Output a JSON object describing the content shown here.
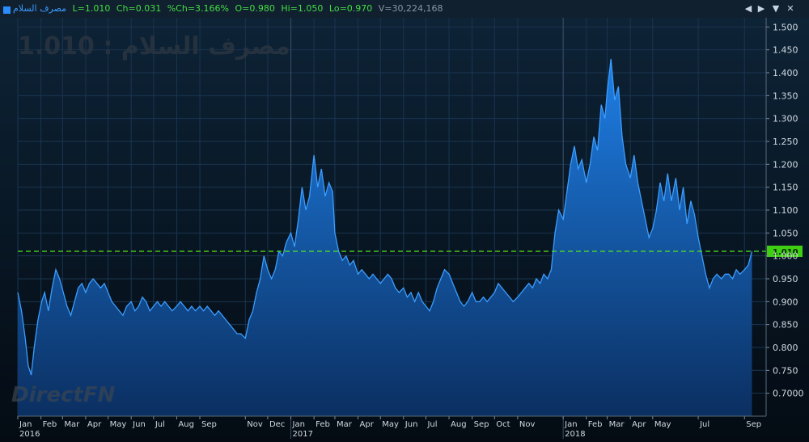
{
  "header": {
    "name": "مصرف السلام",
    "last": "L=1.010",
    "change": "Ch=0.031",
    "pct_change": "%Ch=3.166%",
    "open": "O=0.980",
    "high": "Hi=1.050",
    "low": "Lo=0.970",
    "volume": "V=30,224,168",
    "prev_icon": "triangle-left-icon",
    "next_icon": "triangle-right-icon",
    "menu_icon": "triangle-down-icon",
    "close_icon": "close-icon"
  },
  "watermark": {
    "label": "مصرف السلام",
    "sep": " : ",
    "value": "1.010"
  },
  "logo": "DirectFN",
  "colors": {
    "background": "#060f1a",
    "fill_top": "#1e7fe6",
    "fill_bottom": "#0b2f61",
    "line": "#3b9dff",
    "last_line": "#52e81c",
    "grid": "#1a3550",
    "axis_text": "#d0d8e0",
    "up_text": "#44dd44",
    "name_text": "#3a9bff"
  },
  "chart_data": {
    "type": "area",
    "ylim": [
      0.65,
      1.52
    ],
    "ytick_values": [
      0.7,
      0.75,
      0.8,
      0.85,
      0.9,
      0.95,
      1.0,
      1.05,
      1.1,
      1.15,
      1.2,
      1.25,
      1.3,
      1.35,
      1.4,
      1.45,
      1.5
    ],
    "ytick_labels": [
      "0.7000",
      "0.750",
      "0.800",
      "0.850",
      "0.900",
      "0.950",
      "1.000",
      "1.050",
      "1.100",
      "1.150",
      "1.200",
      "1.250",
      "1.300",
      "1.350",
      "1.400",
      "1.450",
      "1.500"
    ],
    "xlim": [
      "2016-01-01",
      "2018-09-30"
    ],
    "month_ticks": [
      {
        "date": "2016-01-01",
        "label": "Jan",
        "year": "2016"
      },
      {
        "date": "2016-02-01",
        "label": "Feb"
      },
      {
        "date": "2016-03-01",
        "label": "Mar"
      },
      {
        "date": "2016-04-01",
        "label": "Apr"
      },
      {
        "date": "2016-05-01",
        "label": "May"
      },
      {
        "date": "2016-06-01",
        "label": "Jun"
      },
      {
        "date": "2016-07-01",
        "label": "Jul"
      },
      {
        "date": "2016-08-01",
        "label": "Aug"
      },
      {
        "date": "2016-09-01",
        "label": "Sep"
      },
      {
        "date": "2016-11-01",
        "label": "Nov"
      },
      {
        "date": "2016-12-01",
        "label": "Dec"
      },
      {
        "date": "2017-01-01",
        "label": "Jan",
        "year": "2017"
      },
      {
        "date": "2017-02-01",
        "label": "Feb"
      },
      {
        "date": "2017-03-01",
        "label": "Mar"
      },
      {
        "date": "2017-04-01",
        "label": "Apr"
      },
      {
        "date": "2017-05-01",
        "label": "May"
      },
      {
        "date": "2017-06-01",
        "label": "Jun"
      },
      {
        "date": "2017-07-01",
        "label": "Jul"
      },
      {
        "date": "2017-08-01",
        "label": "Aug"
      },
      {
        "date": "2017-09-01",
        "label": "Sep"
      },
      {
        "date": "2017-10-01",
        "label": "Oct"
      },
      {
        "date": "2017-11-01",
        "label": "Nov"
      },
      {
        "date": "2018-01-01",
        "label": "Jan",
        "year": "2018"
      },
      {
        "date": "2018-02-01",
        "label": "Feb"
      },
      {
        "date": "2018-03-01",
        "label": "Mar"
      },
      {
        "date": "2018-04-01",
        "label": "Apr"
      },
      {
        "date": "2018-05-01",
        "label": "May"
      },
      {
        "date": "2018-07-01",
        "label": "Jul"
      },
      {
        "date": "2018-09-01",
        "label": "Sep"
      }
    ],
    "year_dividers": [
      "2017-01-01",
      "2018-01-01"
    ],
    "last_value": 1.01,
    "last_label": "1.010",
    "series": [
      {
        "values": [
          [
            "2016-01-01",
            0.92
          ],
          [
            "2016-01-06",
            0.88
          ],
          [
            "2016-01-11",
            0.82
          ],
          [
            "2016-01-15",
            0.76
          ],
          [
            "2016-01-19",
            0.74
          ],
          [
            "2016-01-23",
            0.8
          ],
          [
            "2016-01-28",
            0.86
          ],
          [
            "2016-02-02",
            0.9
          ],
          [
            "2016-02-06",
            0.92
          ],
          [
            "2016-02-11",
            0.88
          ],
          [
            "2016-02-16",
            0.93
          ],
          [
            "2016-02-21",
            0.97
          ],
          [
            "2016-02-26",
            0.95
          ],
          [
            "2016-03-02",
            0.92
          ],
          [
            "2016-03-07",
            0.89
          ],
          [
            "2016-03-12",
            0.87
          ],
          [
            "2016-03-17",
            0.9
          ],
          [
            "2016-03-22",
            0.93
          ],
          [
            "2016-03-27",
            0.94
          ],
          [
            "2016-04-01",
            0.92
          ],
          [
            "2016-04-06",
            0.94
          ],
          [
            "2016-04-11",
            0.95
          ],
          [
            "2016-04-16",
            0.94
          ],
          [
            "2016-04-21",
            0.93
          ],
          [
            "2016-04-26",
            0.94
          ],
          [
            "2016-05-01",
            0.92
          ],
          [
            "2016-05-06",
            0.9
          ],
          [
            "2016-05-11",
            0.89
          ],
          [
            "2016-05-16",
            0.88
          ],
          [
            "2016-05-21",
            0.87
          ],
          [
            "2016-05-26",
            0.89
          ],
          [
            "2016-06-01",
            0.9
          ],
          [
            "2016-06-06",
            0.88
          ],
          [
            "2016-06-11",
            0.89
          ],
          [
            "2016-06-16",
            0.91
          ],
          [
            "2016-06-21",
            0.9
          ],
          [
            "2016-06-26",
            0.88
          ],
          [
            "2016-07-01",
            0.89
          ],
          [
            "2016-07-06",
            0.9
          ],
          [
            "2016-07-11",
            0.89
          ],
          [
            "2016-07-16",
            0.9
          ],
          [
            "2016-07-21",
            0.89
          ],
          [
            "2016-07-26",
            0.88
          ],
          [
            "2016-08-01",
            0.89
          ],
          [
            "2016-08-06",
            0.9
          ],
          [
            "2016-08-11",
            0.89
          ],
          [
            "2016-08-16",
            0.88
          ],
          [
            "2016-08-21",
            0.89
          ],
          [
            "2016-08-26",
            0.88
          ],
          [
            "2016-09-01",
            0.89
          ],
          [
            "2016-09-06",
            0.88
          ],
          [
            "2016-09-11",
            0.89
          ],
          [
            "2016-09-16",
            0.88
          ],
          [
            "2016-09-21",
            0.87
          ],
          [
            "2016-09-26",
            0.88
          ],
          [
            "2016-10-01",
            0.87
          ],
          [
            "2016-10-06",
            0.86
          ],
          [
            "2016-10-11",
            0.85
          ],
          [
            "2016-10-16",
            0.84
          ],
          [
            "2016-10-21",
            0.83
          ],
          [
            "2016-10-26",
            0.83
          ],
          [
            "2016-11-01",
            0.82
          ],
          [
            "2016-11-06",
            0.86
          ],
          [
            "2016-11-11",
            0.88
          ],
          [
            "2016-11-16",
            0.92
          ],
          [
            "2016-11-21",
            0.95
          ],
          [
            "2016-11-26",
            1.0
          ],
          [
            "2016-12-01",
            0.97
          ],
          [
            "2016-12-06",
            0.95
          ],
          [
            "2016-12-11",
            0.97
          ],
          [
            "2016-12-16",
            1.01
          ],
          [
            "2016-12-21",
            1.0
          ],
          [
            "2016-12-26",
            1.03
          ],
          [
            "2017-01-01",
            1.05
          ],
          [
            "2017-01-06",
            1.02
          ],
          [
            "2017-01-11",
            1.08
          ],
          [
            "2017-01-16",
            1.15
          ],
          [
            "2017-01-21",
            1.1
          ],
          [
            "2017-01-26",
            1.13
          ],
          [
            "2017-02-01",
            1.22
          ],
          [
            "2017-02-06",
            1.15
          ],
          [
            "2017-02-11",
            1.19
          ],
          [
            "2017-02-16",
            1.13
          ],
          [
            "2017-02-21",
            1.16
          ],
          [
            "2017-02-26",
            1.14
          ],
          [
            "2017-03-01",
            1.05
          ],
          [
            "2017-03-06",
            1.01
          ],
          [
            "2017-03-11",
            0.99
          ],
          [
            "2017-03-16",
            1.0
          ],
          [
            "2017-03-21",
            0.98
          ],
          [
            "2017-03-26",
            0.99
          ],
          [
            "2017-04-01",
            0.96
          ],
          [
            "2017-04-06",
            0.97
          ],
          [
            "2017-04-11",
            0.96
          ],
          [
            "2017-04-16",
            0.95
          ],
          [
            "2017-04-21",
            0.96
          ],
          [
            "2017-04-26",
            0.95
          ],
          [
            "2017-05-01",
            0.94
          ],
          [
            "2017-05-06",
            0.95
          ],
          [
            "2017-05-11",
            0.96
          ],
          [
            "2017-05-16",
            0.95
          ],
          [
            "2017-05-21",
            0.93
          ],
          [
            "2017-05-26",
            0.92
          ],
          [
            "2017-06-01",
            0.93
          ],
          [
            "2017-06-06",
            0.91
          ],
          [
            "2017-06-11",
            0.92
          ],
          [
            "2017-06-16",
            0.9
          ],
          [
            "2017-06-21",
            0.92
          ],
          [
            "2017-06-26",
            0.9
          ],
          [
            "2017-07-01",
            0.89
          ],
          [
            "2017-07-06",
            0.88
          ],
          [
            "2017-07-11",
            0.9
          ],
          [
            "2017-07-16",
            0.93
          ],
          [
            "2017-07-21",
            0.95
          ],
          [
            "2017-07-26",
            0.97
          ],
          [
            "2017-08-01",
            0.96
          ],
          [
            "2017-08-06",
            0.94
          ],
          [
            "2017-08-11",
            0.92
          ],
          [
            "2017-08-16",
            0.9
          ],
          [
            "2017-08-21",
            0.89
          ],
          [
            "2017-08-26",
            0.9
          ],
          [
            "2017-09-01",
            0.92
          ],
          [
            "2017-09-06",
            0.9
          ],
          [
            "2017-09-11",
            0.9
          ],
          [
            "2017-09-16",
            0.91
          ],
          [
            "2017-09-21",
            0.9
          ],
          [
            "2017-09-26",
            0.91
          ],
          [
            "2017-10-01",
            0.92
          ],
          [
            "2017-10-06",
            0.94
          ],
          [
            "2017-10-11",
            0.93
          ],
          [
            "2017-10-16",
            0.92
          ],
          [
            "2017-10-21",
            0.91
          ],
          [
            "2017-10-26",
            0.9
          ],
          [
            "2017-11-01",
            0.91
          ],
          [
            "2017-11-06",
            0.92
          ],
          [
            "2017-11-11",
            0.93
          ],
          [
            "2017-11-16",
            0.94
          ],
          [
            "2017-11-21",
            0.93
          ],
          [
            "2017-11-26",
            0.95
          ],
          [
            "2017-12-01",
            0.94
          ],
          [
            "2017-12-06",
            0.96
          ],
          [
            "2017-12-11",
            0.95
          ],
          [
            "2017-12-16",
            0.97
          ],
          [
            "2017-12-21",
            1.05
          ],
          [
            "2017-12-26",
            1.1
          ],
          [
            "2018-01-01",
            1.08
          ],
          [
            "2018-01-06",
            1.14
          ],
          [
            "2018-01-11",
            1.2
          ],
          [
            "2018-01-16",
            1.24
          ],
          [
            "2018-01-21",
            1.19
          ],
          [
            "2018-01-26",
            1.21
          ],
          [
            "2018-02-01",
            1.16
          ],
          [
            "2018-02-06",
            1.2
          ],
          [
            "2018-02-11",
            1.26
          ],
          [
            "2018-02-16",
            1.23
          ],
          [
            "2018-02-21",
            1.33
          ],
          [
            "2018-02-26",
            1.3
          ],
          [
            "2018-03-01",
            1.36
          ],
          [
            "2018-03-06",
            1.43
          ],
          [
            "2018-03-11",
            1.34
          ],
          [
            "2018-03-16",
            1.37
          ],
          [
            "2018-03-21",
            1.26
          ],
          [
            "2018-03-26",
            1.2
          ],
          [
            "2018-04-01",
            1.17
          ],
          [
            "2018-04-06",
            1.22
          ],
          [
            "2018-04-11",
            1.16
          ],
          [
            "2018-04-16",
            1.12
          ],
          [
            "2018-04-21",
            1.08
          ],
          [
            "2018-04-26",
            1.04
          ],
          [
            "2018-05-01",
            1.06
          ],
          [
            "2018-05-06",
            1.1
          ],
          [
            "2018-05-11",
            1.16
          ],
          [
            "2018-05-16",
            1.12
          ],
          [
            "2018-05-21",
            1.18
          ],
          [
            "2018-05-26",
            1.12
          ],
          [
            "2018-06-01",
            1.17
          ],
          [
            "2018-06-06",
            1.1
          ],
          [
            "2018-06-11",
            1.15
          ],
          [
            "2018-06-16",
            1.07
          ],
          [
            "2018-06-21",
            1.12
          ],
          [
            "2018-06-26",
            1.09
          ],
          [
            "2018-07-01",
            1.04
          ],
          [
            "2018-07-06",
            1.0
          ],
          [
            "2018-07-11",
            0.96
          ],
          [
            "2018-07-16",
            0.93
          ],
          [
            "2018-07-21",
            0.95
          ],
          [
            "2018-07-26",
            0.96
          ],
          [
            "2018-08-01",
            0.95
          ],
          [
            "2018-08-06",
            0.96
          ],
          [
            "2018-08-11",
            0.96
          ],
          [
            "2018-08-16",
            0.95
          ],
          [
            "2018-08-21",
            0.97
          ],
          [
            "2018-08-26",
            0.96
          ],
          [
            "2018-09-01",
            0.97
          ],
          [
            "2018-09-06",
            0.98
          ],
          [
            "2018-09-11",
            1.01
          ]
        ]
      }
    ]
  }
}
